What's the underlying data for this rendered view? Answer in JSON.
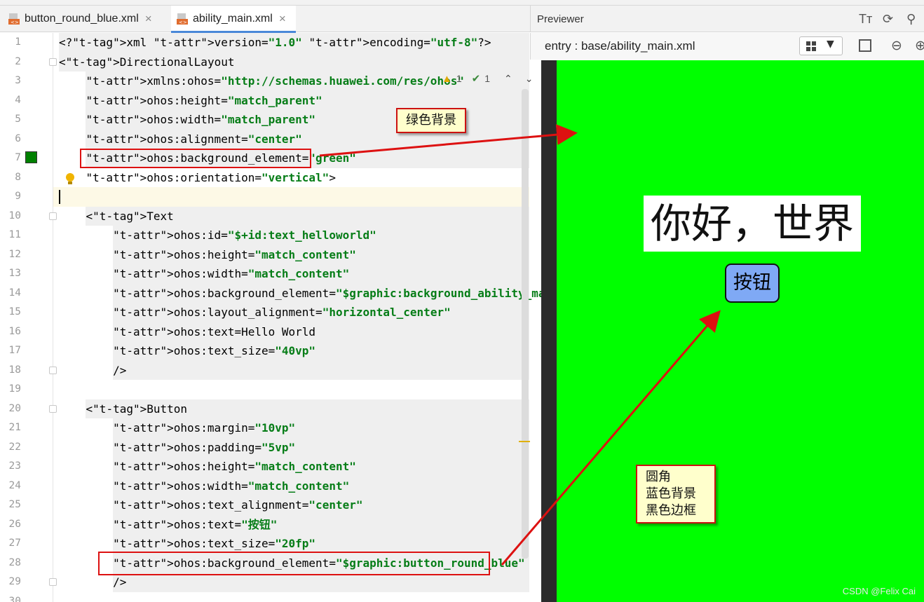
{
  "tabs": [
    {
      "label": "button_round_blue.xml",
      "active": false
    },
    {
      "label": "ability_main.xml",
      "active": true
    }
  ],
  "inspections": {
    "warnings": "1",
    "checks": "1"
  },
  "editor": {
    "lines": [
      {
        "n": "1",
        "code": "<?xml version=\"1.0\" encoding=\"utf-8\"?>"
      },
      {
        "n": "2",
        "code": "<DirectionalLayout"
      },
      {
        "n": "3",
        "code": "    xmlns:ohos=\"http://schemas.huawei.com/res/ohos\""
      },
      {
        "n": "4",
        "code": "    ohos:height=\"match_parent\""
      },
      {
        "n": "5",
        "code": "    ohos:width=\"match_parent\""
      },
      {
        "n": "6",
        "code": "    ohos:alignment=\"center\""
      },
      {
        "n": "7",
        "code": "    ohos:background_element=\"green\""
      },
      {
        "n": "8",
        "code": "    ohos:orientation=\"vertical\">"
      },
      {
        "n": "9",
        "code": ""
      },
      {
        "n": "10",
        "code": "    <Text"
      },
      {
        "n": "11",
        "code": "        ohos:id=\"$+id:text_helloworld\""
      },
      {
        "n": "12",
        "code": "        ohos:height=\"match_content\""
      },
      {
        "n": "13",
        "code": "        ohos:width=\"match_content\""
      },
      {
        "n": "14",
        "code": "        ohos:background_element=\"$graphic:background_ability_main\""
      },
      {
        "n": "15",
        "code": "        ohos:layout_alignment=\"horizontal_center\""
      },
      {
        "n": "16",
        "code": "        ohos:text=Hello World"
      },
      {
        "n": "17",
        "code": "        ohos:text_size=\"40vp\""
      },
      {
        "n": "18",
        "code": "        />"
      },
      {
        "n": "19",
        "code": ""
      },
      {
        "n": "20",
        "code": "    <Button"
      },
      {
        "n": "21",
        "code": "        ohos:margin=\"10vp\""
      },
      {
        "n": "22",
        "code": "        ohos:padding=\"5vp\""
      },
      {
        "n": "23",
        "code": "        ohos:height=\"match_content\""
      },
      {
        "n": "24",
        "code": "        ohos:width=\"match_content\""
      },
      {
        "n": "25",
        "code": "        ohos:text_alignment=\"center\""
      },
      {
        "n": "26",
        "code": "        ohos:text=\"按钮\""
      },
      {
        "n": "27",
        "code": "        ohos:text_size=\"20fp\""
      },
      {
        "n": "28",
        "code": "        ohos:background_element=\"$graphic:button_round_blue\""
      },
      {
        "n": "29",
        "code": "        />"
      },
      {
        "n": "30",
        "code": ""
      }
    ]
  },
  "previewer": {
    "title": "Previewer",
    "path": "entry : base/ability_main.xml",
    "hello_text": "你好，世界",
    "button_text": "按钮",
    "device_background": "#00ff00",
    "button_background": "#7fa9f5"
  },
  "annotations": {
    "green_bg": "绿色背景",
    "button_note_lines": [
      "圆角",
      "蓝色背景",
      "黑色边框"
    ]
  },
  "watermark": "CSDN @Felix Cai"
}
